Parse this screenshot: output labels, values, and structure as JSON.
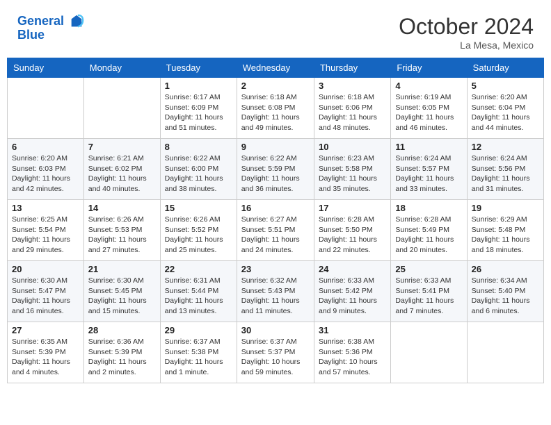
{
  "header": {
    "logo_line1": "General",
    "logo_line2": "Blue",
    "month": "October 2024",
    "location": "La Mesa, Mexico"
  },
  "weekdays": [
    "Sunday",
    "Monday",
    "Tuesday",
    "Wednesday",
    "Thursday",
    "Friday",
    "Saturday"
  ],
  "weeks": [
    [
      {
        "day": "",
        "info": ""
      },
      {
        "day": "",
        "info": ""
      },
      {
        "day": "1",
        "info": "Sunrise: 6:17 AM\nSunset: 6:09 PM\nDaylight: 11 hours and 51 minutes."
      },
      {
        "day": "2",
        "info": "Sunrise: 6:18 AM\nSunset: 6:08 PM\nDaylight: 11 hours and 49 minutes."
      },
      {
        "day": "3",
        "info": "Sunrise: 6:18 AM\nSunset: 6:06 PM\nDaylight: 11 hours and 48 minutes."
      },
      {
        "day": "4",
        "info": "Sunrise: 6:19 AM\nSunset: 6:05 PM\nDaylight: 11 hours and 46 minutes."
      },
      {
        "day": "5",
        "info": "Sunrise: 6:20 AM\nSunset: 6:04 PM\nDaylight: 11 hours and 44 minutes."
      }
    ],
    [
      {
        "day": "6",
        "info": "Sunrise: 6:20 AM\nSunset: 6:03 PM\nDaylight: 11 hours and 42 minutes."
      },
      {
        "day": "7",
        "info": "Sunrise: 6:21 AM\nSunset: 6:02 PM\nDaylight: 11 hours and 40 minutes."
      },
      {
        "day": "8",
        "info": "Sunrise: 6:22 AM\nSunset: 6:00 PM\nDaylight: 11 hours and 38 minutes."
      },
      {
        "day": "9",
        "info": "Sunrise: 6:22 AM\nSunset: 5:59 PM\nDaylight: 11 hours and 36 minutes."
      },
      {
        "day": "10",
        "info": "Sunrise: 6:23 AM\nSunset: 5:58 PM\nDaylight: 11 hours and 35 minutes."
      },
      {
        "day": "11",
        "info": "Sunrise: 6:24 AM\nSunset: 5:57 PM\nDaylight: 11 hours and 33 minutes."
      },
      {
        "day": "12",
        "info": "Sunrise: 6:24 AM\nSunset: 5:56 PM\nDaylight: 11 hours and 31 minutes."
      }
    ],
    [
      {
        "day": "13",
        "info": "Sunrise: 6:25 AM\nSunset: 5:54 PM\nDaylight: 11 hours and 29 minutes."
      },
      {
        "day": "14",
        "info": "Sunrise: 6:26 AM\nSunset: 5:53 PM\nDaylight: 11 hours and 27 minutes."
      },
      {
        "day": "15",
        "info": "Sunrise: 6:26 AM\nSunset: 5:52 PM\nDaylight: 11 hours and 25 minutes."
      },
      {
        "day": "16",
        "info": "Sunrise: 6:27 AM\nSunset: 5:51 PM\nDaylight: 11 hours and 24 minutes."
      },
      {
        "day": "17",
        "info": "Sunrise: 6:28 AM\nSunset: 5:50 PM\nDaylight: 11 hours and 22 minutes."
      },
      {
        "day": "18",
        "info": "Sunrise: 6:28 AM\nSunset: 5:49 PM\nDaylight: 11 hours and 20 minutes."
      },
      {
        "day": "19",
        "info": "Sunrise: 6:29 AM\nSunset: 5:48 PM\nDaylight: 11 hours and 18 minutes."
      }
    ],
    [
      {
        "day": "20",
        "info": "Sunrise: 6:30 AM\nSunset: 5:47 PM\nDaylight: 11 hours and 16 minutes."
      },
      {
        "day": "21",
        "info": "Sunrise: 6:30 AM\nSunset: 5:45 PM\nDaylight: 11 hours and 15 minutes."
      },
      {
        "day": "22",
        "info": "Sunrise: 6:31 AM\nSunset: 5:44 PM\nDaylight: 11 hours and 13 minutes."
      },
      {
        "day": "23",
        "info": "Sunrise: 6:32 AM\nSunset: 5:43 PM\nDaylight: 11 hours and 11 minutes."
      },
      {
        "day": "24",
        "info": "Sunrise: 6:33 AM\nSunset: 5:42 PM\nDaylight: 11 hours and 9 minutes."
      },
      {
        "day": "25",
        "info": "Sunrise: 6:33 AM\nSunset: 5:41 PM\nDaylight: 11 hours and 7 minutes."
      },
      {
        "day": "26",
        "info": "Sunrise: 6:34 AM\nSunset: 5:40 PM\nDaylight: 11 hours and 6 minutes."
      }
    ],
    [
      {
        "day": "27",
        "info": "Sunrise: 6:35 AM\nSunset: 5:39 PM\nDaylight: 11 hours and 4 minutes."
      },
      {
        "day": "28",
        "info": "Sunrise: 6:36 AM\nSunset: 5:39 PM\nDaylight: 11 hours and 2 minutes."
      },
      {
        "day": "29",
        "info": "Sunrise: 6:37 AM\nSunset: 5:38 PM\nDaylight: 11 hours and 1 minute."
      },
      {
        "day": "30",
        "info": "Sunrise: 6:37 AM\nSunset: 5:37 PM\nDaylight: 10 hours and 59 minutes."
      },
      {
        "day": "31",
        "info": "Sunrise: 6:38 AM\nSunset: 5:36 PM\nDaylight: 10 hours and 57 minutes."
      },
      {
        "day": "",
        "info": ""
      },
      {
        "day": "",
        "info": ""
      }
    ]
  ]
}
